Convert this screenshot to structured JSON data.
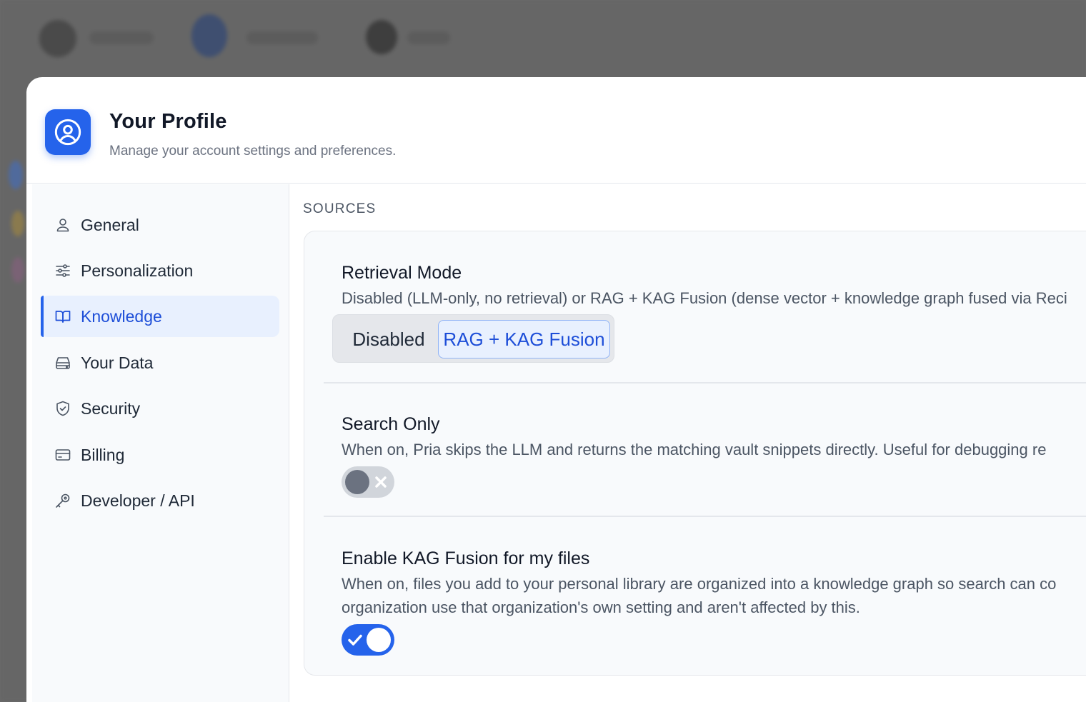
{
  "colors": {
    "accent": "#2563eb",
    "accent_light": "#e8f0fe",
    "overlay": "#6b6b6b",
    "text_primary": "#111827",
    "text_secondary": "#4b5563"
  },
  "header": {
    "icon": "user-circle-icon",
    "title": "Your Profile",
    "subtitle": "Manage your account settings and preferences."
  },
  "sidebar": {
    "items": [
      {
        "label": "General",
        "icon": "user-icon",
        "active": false
      },
      {
        "label": "Personalization",
        "icon": "sliders-icon",
        "active": false
      },
      {
        "label": "Knowledge",
        "icon": "book-open-icon",
        "active": true
      },
      {
        "label": "Your Data",
        "icon": "hard-drive-icon",
        "active": false
      },
      {
        "label": "Security",
        "icon": "shield-check-icon",
        "active": false
      },
      {
        "label": "Billing",
        "icon": "credit-card-icon",
        "active": false
      },
      {
        "label": "Developer / API",
        "icon": "key-icon",
        "active": false
      }
    ]
  },
  "main": {
    "section_label": "SOURCES",
    "settings": {
      "retrieval_mode": {
        "title": "Retrieval Mode",
        "description": "Disabled (LLM-only, no retrieval) or RAG + KAG Fusion (dense vector + knowledge graph fused via Reci",
        "options": [
          "Disabled",
          "RAG + KAG Fusion"
        ],
        "selected": "RAG + KAG Fusion"
      },
      "search_only": {
        "title": "Search Only",
        "description": "When on, Pria skips the LLM and returns the matching vault snippets directly. Useful for debugging re",
        "enabled": false
      },
      "kag_fusion": {
        "title": "Enable KAG Fusion for my files",
        "description_line1": "When on, files you add to your personal library are organized into a knowledge graph so search can co",
        "description_line2": "organization use that organization's own setting and aren't affected by this.",
        "enabled": true
      }
    }
  }
}
